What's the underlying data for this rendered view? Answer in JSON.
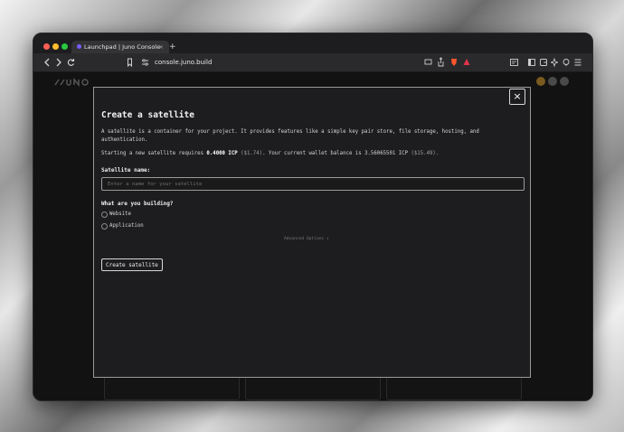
{
  "browser": {
    "tab_title": "Launchpad | Juno Console",
    "tab_close": "×",
    "new_tab": "+",
    "url": "console.juno.build",
    "icons": [
      "back-icon",
      "forward-icon",
      "reload-icon",
      "bookmark-icon",
      "site-info-icon",
      "cast-icon",
      "share-icon",
      "brave-shield-icon",
      "brave-rewards-icon",
      "reader-icon",
      "sidebar-icon",
      "wallet-icon",
      "leo-icon",
      "vpn-icon",
      "menu-icon"
    ]
  },
  "modal": {
    "close": "×",
    "title": "Create a satellite",
    "description": "A satellite is a container for your project. It provides features like a simple key pair store, file storage, hosting, and authentication.",
    "cost_prefix": "Starting a new satellite requires ",
    "cost_icp": "0.4000 ICP",
    "cost_usd": " ($1.74)",
    "balance_prefix": ". Your current wallet balance is ",
    "balance_icp": "3.56065501 ICP",
    "balance_usd": " ($15.49).",
    "name_label": "Satellite name:",
    "name_placeholder": "Enter a name for your satellite",
    "building_label": "What are you building?",
    "options": [
      "Website",
      "Application"
    ],
    "advanced": "Advanced Options",
    "advanced_chevron": "⇕",
    "create_button": "Create satellite"
  }
}
